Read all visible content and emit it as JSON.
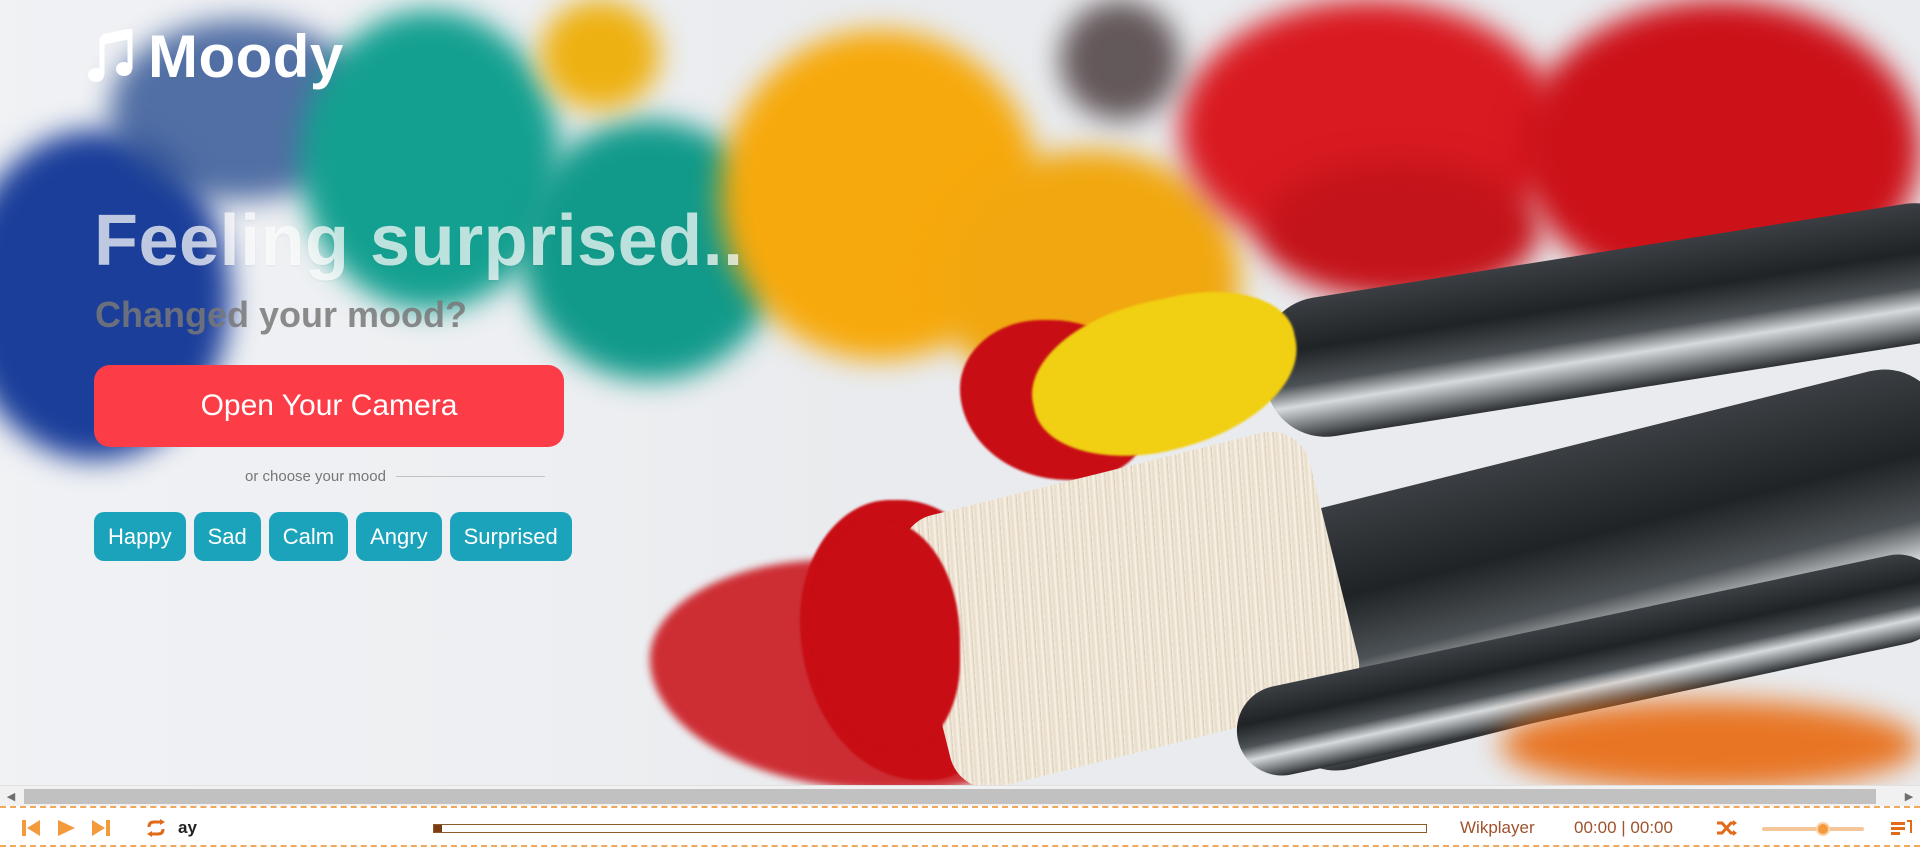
{
  "app": {
    "name": "Moody",
    "logo_icon": "music-note-icon"
  },
  "hero": {
    "headline": "Feeling surprised..",
    "subline": "Changed your mood?",
    "camera_button_label": "Open Your Camera",
    "divider_text": "or choose your mood",
    "mood_buttons": [
      "Happy",
      "Sad",
      "Calm",
      "Angry",
      "Surprised"
    ]
  },
  "player": {
    "brand": "Wikplayer",
    "time_display": "00:00 | 00:00",
    "track_title_visible": "ay",
    "progress": 0.0,
    "volume": 0.6,
    "icons": [
      "previous-icon",
      "play-icon",
      "next-icon",
      "repeat-icon",
      "shuffle-icon",
      "playlist-icon"
    ]
  },
  "colors": {
    "camera_button": "#fc3d47",
    "mood_button": "#1aa3bb",
    "player_accent": "#f39a3c",
    "player_text": "#a0522d"
  }
}
